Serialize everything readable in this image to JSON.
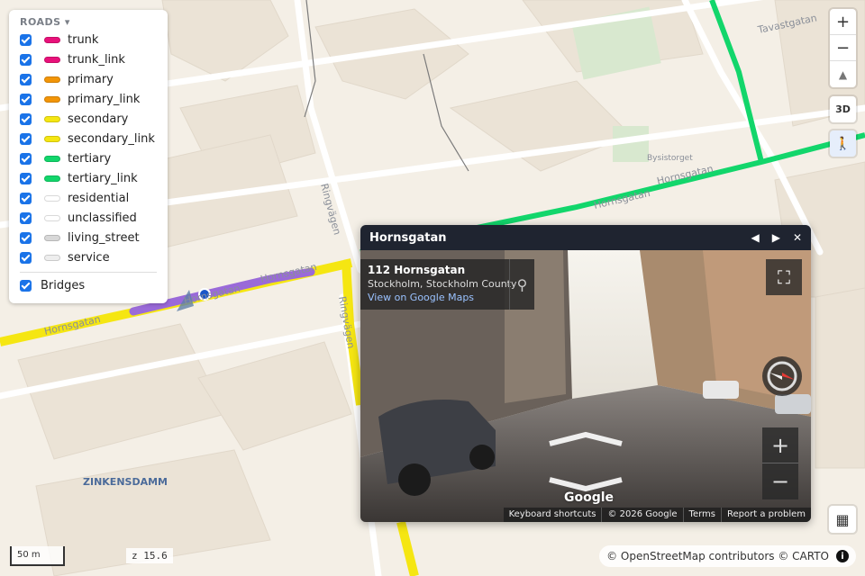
{
  "legend": {
    "title": "ROADS ▾",
    "items": [
      {
        "label": "trunk",
        "color": "#e8117a"
      },
      {
        "label": "trunk_link",
        "color": "#e8117a"
      },
      {
        "label": "primary",
        "color": "#f29507"
      },
      {
        "label": "primary_link",
        "color": "#f29507"
      },
      {
        "label": "secondary",
        "color": "#f5e612"
      },
      {
        "label": "secondary_link",
        "color": "#f5e612"
      },
      {
        "label": "tertiary",
        "color": "#12d66b"
      },
      {
        "label": "tertiary_link",
        "color": "#12d66b"
      },
      {
        "label": "residential",
        "color": "#ffffff"
      },
      {
        "label": "unclassified",
        "color": "#ffffff"
      },
      {
        "label": "living_street",
        "color": "#d8d8d8"
      },
      {
        "label": "service",
        "color": "#eeeeee"
      }
    ],
    "bridges_label": "Bridges"
  },
  "map": {
    "labels": {
      "hornsgatan": "Hornsgatan",
      "ringvagen": "Ringvägen",
      "tavastgatan": "Tavastgatan",
      "bysistorget": "Bysistorget",
      "zinkensdamm": "ZINKENSDAMM",
      "sagardsgatan": "Sågårdsgatan",
      "uasstugatan": "...astugatan"
    },
    "controls": {
      "zoom_in": "+",
      "zoom_out": "−",
      "compass": "▲",
      "three_d": "3D",
      "pegman": "🚶"
    },
    "scale": "50 m",
    "zoom_level": "z 15.6",
    "attribution": "© OpenStreetMap contributors © CARTO",
    "info": "i",
    "grid": "▦"
  },
  "streetview": {
    "title": "Hornsgatan",
    "prev": "◀",
    "next": "▶",
    "close": "✕",
    "address": "112 Hornsgatan",
    "city": "Stockholm, Stockholm County",
    "view_link": "View on Google Maps",
    "google": "Google",
    "fullscreen": "⛶",
    "zoom_in": "+",
    "zoom_out": "−",
    "footer": [
      "Keyboard shortcuts",
      "© 2026 Google",
      "Terms",
      "Report a problem"
    ]
  }
}
